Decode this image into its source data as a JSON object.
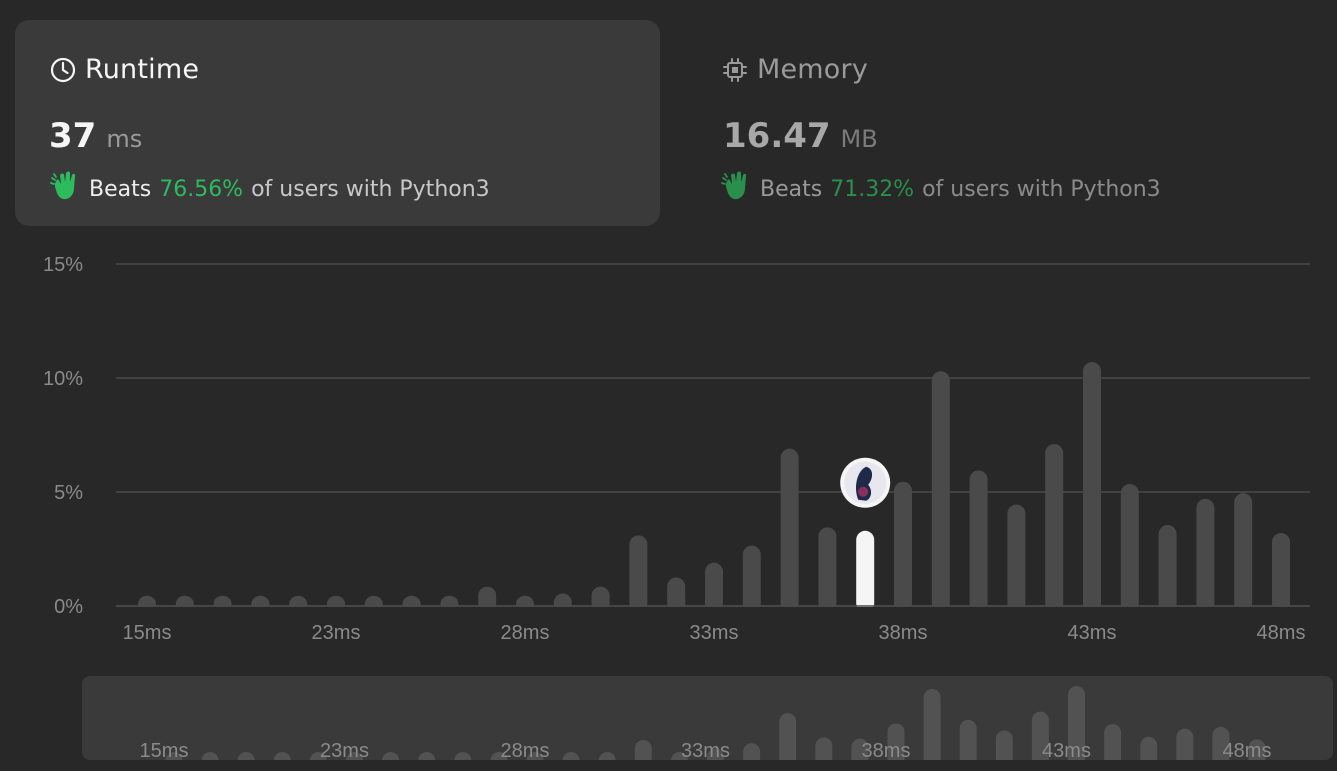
{
  "runtime": {
    "icon": "clock-icon",
    "title": "Runtime",
    "value": "37",
    "unit": "ms",
    "beats_label": "Beats",
    "beats_pct": "76.56%",
    "beats_tail": "of users with Python3",
    "beats_icon": "clap-icon"
  },
  "memory": {
    "icon": "chip-icon",
    "title": "Memory",
    "value": "16.47",
    "unit": "MB",
    "beats_label": "Beats",
    "beats_pct": "71.32%",
    "beats_tail": "of users with Python3",
    "beats_icon": "clap-icon"
  },
  "colors": {
    "accent_green": "#2cbb5d",
    "bar": "#4a4a4a",
    "bar_highlight": "#f5f5f5",
    "grid": "#4a4a4a",
    "axis_text": "#8a8a8a",
    "nav_bar": "#525252"
  },
  "chart_data": {
    "type": "bar",
    "ylabel": "",
    "xlabel": "",
    "y_ticks": [
      "0%",
      "5%",
      "10%",
      "15%"
    ],
    "ylim": [
      0,
      15
    ],
    "x_tick_labels": [
      "15ms",
      "23ms",
      "28ms",
      "33ms",
      "38ms",
      "43ms",
      "48ms"
    ],
    "x_tick_index": [
      0,
      5,
      10,
      15,
      20,
      25,
      30
    ],
    "highlight_index": 19,
    "highlight_avatar": "user-avatar",
    "values": [
      0.45,
      0.45,
      0.45,
      0.45,
      0.45,
      0.45,
      0.45,
      0.45,
      0.45,
      0.85,
      0.45,
      0.55,
      0.85,
      3.1,
      1.25,
      1.9,
      2.65,
      6.9,
      3.45,
      3.3,
      5.45,
      10.3,
      5.95,
      4.45,
      7.1,
      10.7,
      5.35,
      3.55,
      4.7,
      4.95,
      3.2
    ],
    "grid": true,
    "legend": "none"
  },
  "navigator": {
    "x_tick_labels": [
      "15ms",
      "23ms",
      "28ms",
      "33ms",
      "38ms",
      "43ms",
      "48ms"
    ]
  }
}
